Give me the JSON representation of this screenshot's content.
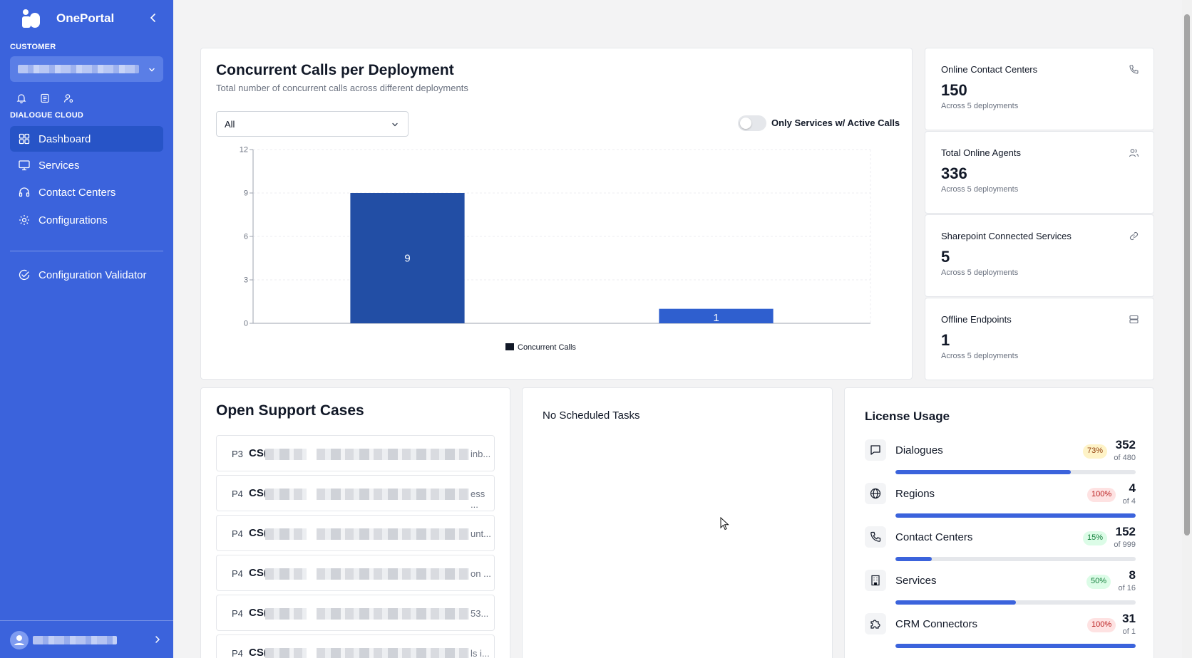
{
  "sidebar": {
    "brand": "OnePortal",
    "customer_label": "CUSTOMER",
    "section_label": "DIALOGUE CLOUD",
    "nav": [
      {
        "label": "Dashboard",
        "icon": "dashboard-icon",
        "active": true
      },
      {
        "label": "Services",
        "icon": "monitor-icon"
      },
      {
        "label": "Contact Centers",
        "icon": "headset-icon"
      },
      {
        "label": "Configurations",
        "icon": "gear-icon"
      }
    ],
    "validator_label": "Configuration Validator"
  },
  "chart_card": {
    "title": "Concurrent Calls per Deployment",
    "subtitle": "Total number of concurrent calls across different deployments",
    "dropdown_value": "All",
    "toggle_label": "Only Services w/ Active Calls"
  },
  "chart_data": {
    "type": "bar",
    "categories": [
      "",
      ""
    ],
    "series": [
      {
        "name": "Concurrent Calls",
        "values": [
          9,
          1
        ]
      }
    ],
    "ylim": [
      0,
      12
    ],
    "yticks": [
      "0",
      "3",
      "6",
      "9",
      "12"
    ],
    "grid": true,
    "legend": "bottom-center",
    "colors": [
      "#224ea5",
      "#2f5fcf"
    ]
  },
  "stats": [
    {
      "title": "Online Contact Centers",
      "value": "150",
      "sub": "Across 5 deployments",
      "icon": "phone-icon"
    },
    {
      "title": "Total Online Agents",
      "value": "336",
      "sub": "Across 5 deployments",
      "icon": "users-icon"
    },
    {
      "title": "Sharepoint Connected Services",
      "value": "5",
      "sub": "Across 5 deployments",
      "icon": "link-icon"
    },
    {
      "title": "Offline Endpoints",
      "value": "1",
      "sub": "Across 5 deployments",
      "icon": "server-icon"
    }
  ],
  "cases": {
    "title": "Open Support Cases",
    "rows": [
      {
        "priority": "P3",
        "id": "CS(",
        "tail": "inb..."
      },
      {
        "priority": "P4",
        "id": "CS(",
        "tail": "ess ..."
      },
      {
        "priority": "P4",
        "id": "CS(",
        "tail": "unt..."
      },
      {
        "priority": "P4",
        "id": "CS(",
        "tail": "on ..."
      },
      {
        "priority": "P4",
        "id": "CS(",
        "tail": "53..."
      },
      {
        "priority": "P4",
        "id": "CS(",
        "tail": "ls i..."
      }
    ]
  },
  "tasks": {
    "empty_text": "No Scheduled Tasks"
  },
  "license": {
    "title": "License Usage",
    "items": [
      {
        "name": "Dialogues",
        "pct": "73%",
        "used": "352",
        "total": "of 480",
        "fraction": 0.73,
        "badge": "#fef3c7",
        "badge_text": "#92400e",
        "icon": "chat-icon"
      },
      {
        "name": "Regions",
        "pct": "100%",
        "used": "4",
        "total": "of 4",
        "fraction": 1.0,
        "badge": "#fee2e2",
        "badge_text": "#b91c1c",
        "icon": "globe-icon"
      },
      {
        "name": "Contact Centers",
        "pct": "15%",
        "used": "152",
        "total": "of 999",
        "fraction": 0.15,
        "badge": "#dcfce7",
        "badge_text": "#15803d",
        "icon": "phone-icon"
      },
      {
        "name": "Services",
        "pct": "50%",
        "used": "8",
        "total": "of 16",
        "fraction": 0.5,
        "badge": "#dcfce7",
        "badge_text": "#15803d",
        "icon": "building-icon"
      },
      {
        "name": "CRM Connectors",
        "pct": "100%",
        "used": "31",
        "total": "of 1",
        "fraction": 1.0,
        "badge": "#fee2e2",
        "badge_text": "#b91c1c",
        "icon": "puzzle-icon"
      }
    ]
  }
}
